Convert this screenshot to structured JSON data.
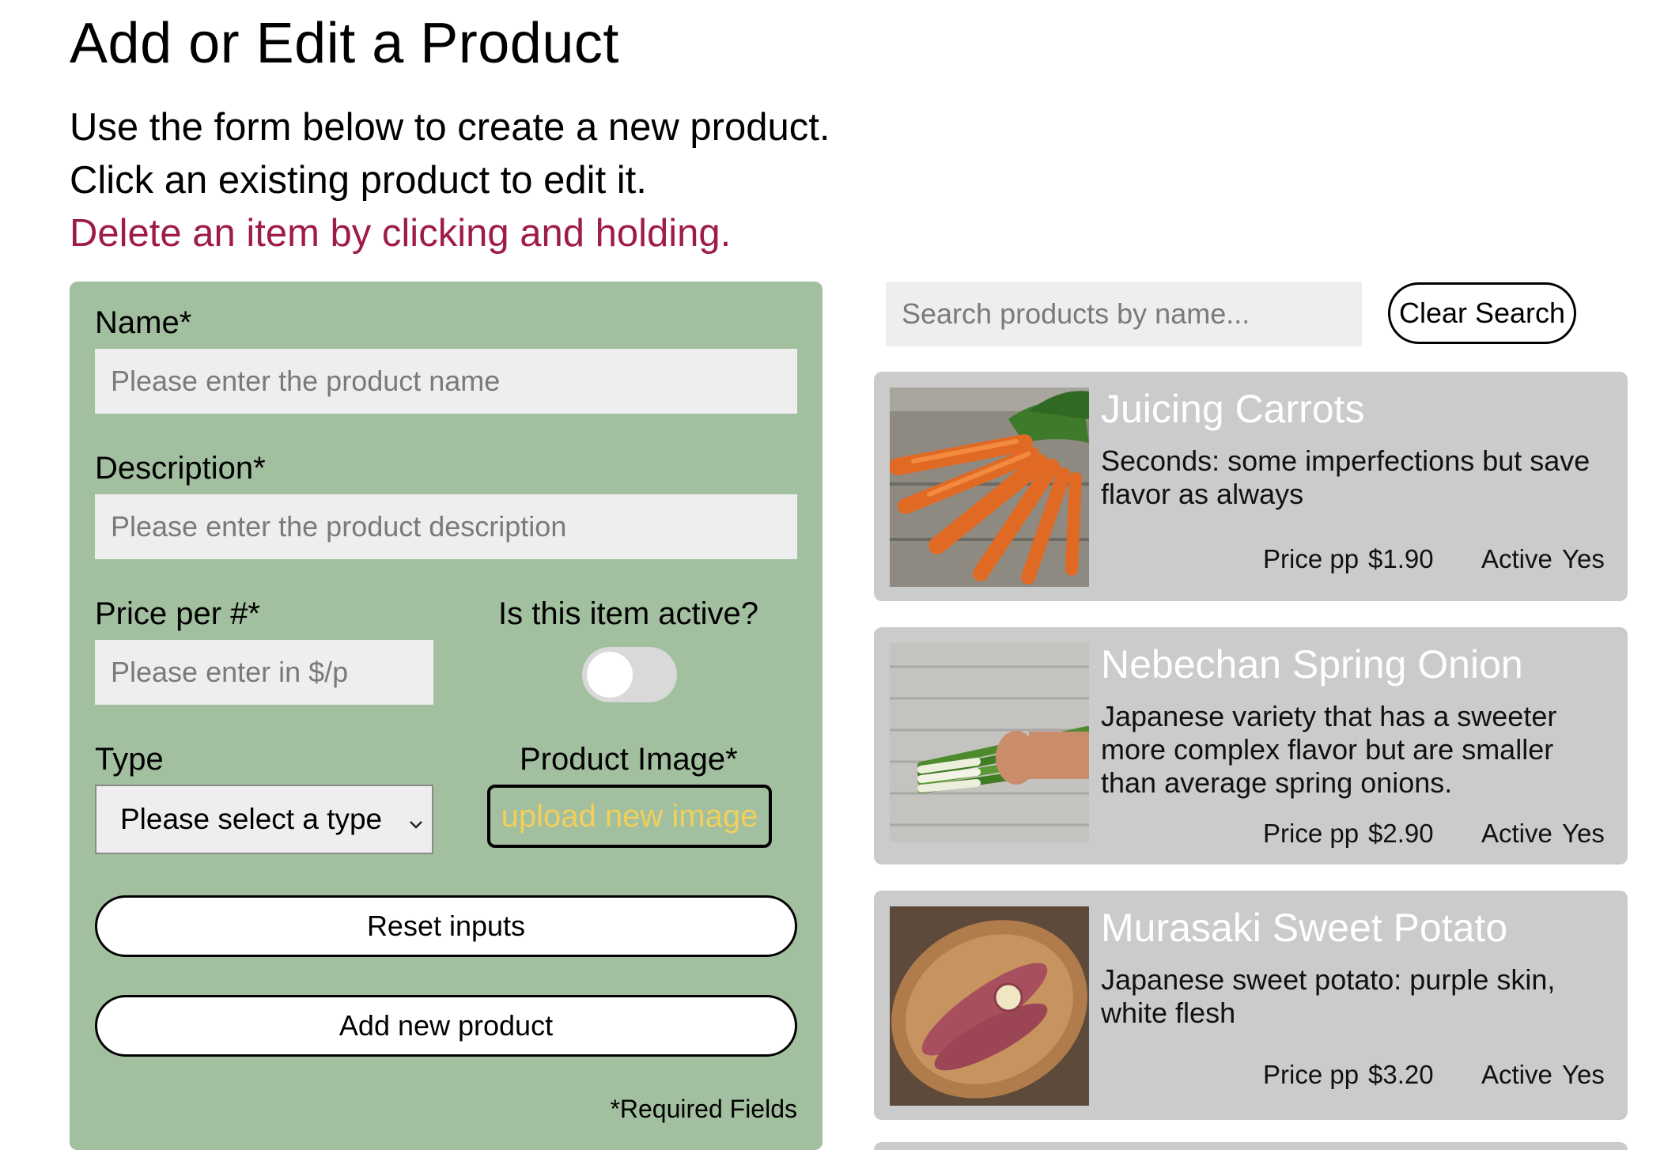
{
  "header": {
    "title": "Add or Edit a Product",
    "line1": "Use the form below to create a new product.",
    "line2": "Click an existing product to edit it.",
    "line3": "Delete an item by clicking and holding."
  },
  "form": {
    "name_label": "Name*",
    "name_placeholder": "Please enter the product name",
    "description_label": "Description*",
    "description_placeholder": "Please enter the product description",
    "price_label": "Price per #*",
    "price_placeholder": "Please enter in $/p",
    "active_label": "Is this item active?",
    "active_value": false,
    "type_label": "Type",
    "type_selected": "Please select a type",
    "image_label": "Product Image*",
    "upload_label": "upload new image",
    "reset_label": "Reset inputs",
    "add_label": "Add new product",
    "required_note": "*Required Fields"
  },
  "search": {
    "placeholder": "Search products by name...",
    "clear_label": "Clear Search"
  },
  "meta_labels": {
    "price": "Price pp",
    "active": "Active"
  },
  "products": [
    {
      "name": "Juicing Carrots",
      "description": "Seconds: some imperfections but save flavor as always",
      "price": "$1.90",
      "active": "Yes",
      "image_icon": "carrots-photo"
    },
    {
      "name": "Nebechan Spring Onion",
      "description": "Japanese variety that has a sweeter more complex flavor but are smaller than average spring onions.",
      "price": "$2.90",
      "active": "Yes",
      "image_icon": "spring-onion-photo"
    },
    {
      "name": "Murasaki Sweet Potato",
      "description": "Japanese sweet potato: purple skin, white flesh",
      "price": "$3.20",
      "active": "Yes",
      "image_icon": "sweet-potato-photo"
    }
  ],
  "colors": {
    "form_bg": "#a2bf9f",
    "card_bg": "#cbcbcb",
    "warning_text": "#9e1c45",
    "upload_text": "#f2d05b"
  }
}
